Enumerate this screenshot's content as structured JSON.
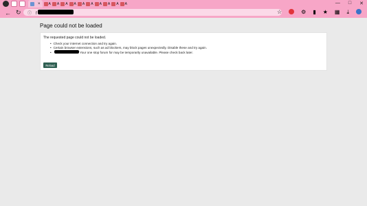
{
  "browser": {
    "tabs": {
      "active_title": "",
      "mini_label": "A"
    },
    "address": {
      "url_prefix": "f"
    },
    "controls": {
      "minimize": "—",
      "maximize": "□",
      "close": "✕"
    }
  },
  "page": {
    "heading": "Page could not be loaded",
    "message": "The requested page could not be loaded.",
    "bullets": [
      "Check your internet connection and try again.",
      "Certain browser extensions, such as ad blockers, may block pages unexpectedly. Disable these and try again.",
      "Your one stop forum for  may be temporarily unavailable. Please check back later."
    ],
    "reload_label": "Reload"
  }
}
